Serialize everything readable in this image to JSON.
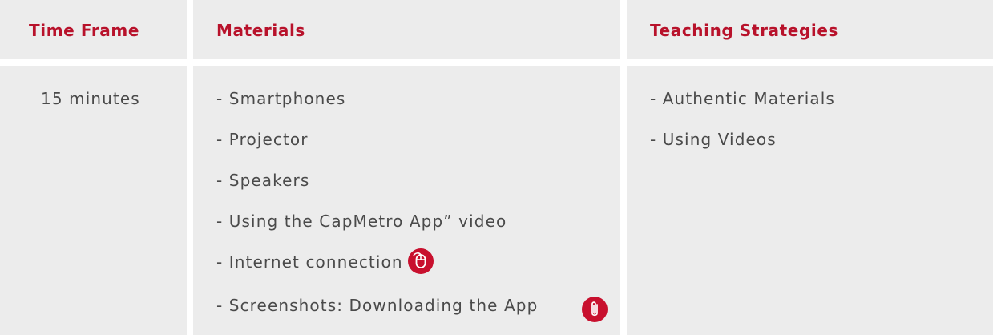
{
  "table": {
    "headers": {
      "time_frame": "Time Frame",
      "materials": "Materials",
      "teaching_strategies": "Teaching Strategies"
    },
    "time_frame_value": "15 minutes",
    "materials": [
      {
        "text": "- Smartphones"
      },
      {
        "text": "- Projector"
      },
      {
        "text": "- Speakers"
      },
      {
        "text": "- Using the CapMetro App” video"
      },
      {
        "text": "- Internet connection",
        "icon": "mouse-icon"
      },
      {
        "text": "- Screenshots: Downloading the App",
        "icon": "paperclip-icon"
      }
    ],
    "teaching_strategies": [
      "- Authentic Materials",
      "- Using Videos"
    ]
  },
  "colors": {
    "header_text": "#b8122b",
    "body_text": "#4a4a4a",
    "cell_background": "#ececec",
    "divider": "#ffffff",
    "icon_badge": "#c8102e"
  }
}
